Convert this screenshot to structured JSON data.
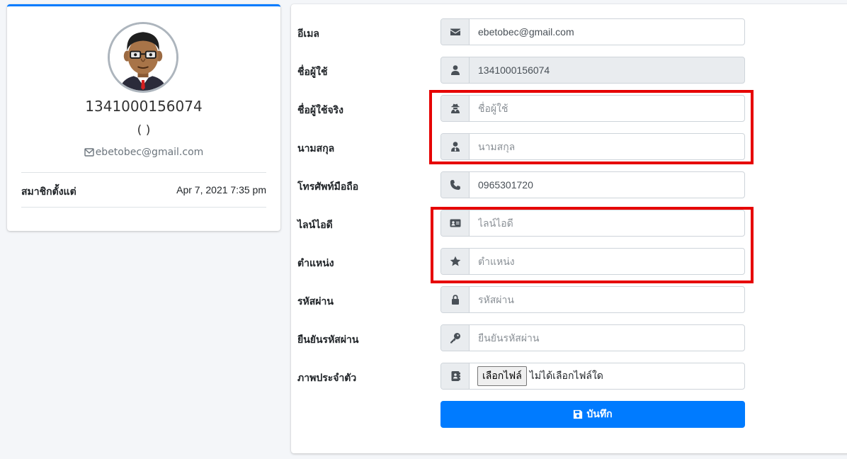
{
  "profile": {
    "username": "1341000156074",
    "fullname": "( )",
    "email": "ebetobec@gmail.com",
    "member_since_label": "สมาชิกตั้งแต่",
    "member_since_value": "Apr 7, 2021 7:35 pm"
  },
  "form": {
    "email": {
      "label": "อีเมล",
      "value": "ebetobec@gmail.com",
      "icon": "envelope-icon"
    },
    "username": {
      "label": "ชื่อผู้ใช้",
      "value": "1341000156074",
      "icon": "user-icon"
    },
    "firstname": {
      "label": "ชื่อผู้ใช้จริง",
      "placeholder": "ชื่อผู้ใช้",
      "icon": "user-secret-icon"
    },
    "lastname": {
      "label": "นามสกุล",
      "placeholder": "นามสกุล",
      "icon": "user-tie-icon"
    },
    "phone": {
      "label": "โทรศัพท์มือถือ",
      "value": "0965301720",
      "icon": "phone-icon"
    },
    "line_id": {
      "label": "ไลน์ไอดี",
      "placeholder": "ไลน์ไอดี",
      "icon": "id-card-icon"
    },
    "position": {
      "label": "ตำแหน่ง",
      "placeholder": "ตำแหน่ง",
      "icon": "star-icon"
    },
    "password": {
      "label": "รหัสผ่าน",
      "placeholder": "รหัสผ่าน",
      "icon": "lock-icon"
    },
    "confirm_password": {
      "label": "ยืนยันรหัสผ่าน",
      "placeholder": "ยืนยันรหัสผ่าน",
      "icon": "key-icon"
    },
    "avatar": {
      "label": "ภาพประจำตัว",
      "button": "เลือกไฟล์",
      "status": "ไม่ได้เลือกไฟล์ใด",
      "icon": "address-book-icon"
    },
    "save_label": "บันทึก"
  },
  "colors": {
    "primary": "#007bff",
    "highlight": "#e60000",
    "addon_bg": "#e9ecef"
  }
}
